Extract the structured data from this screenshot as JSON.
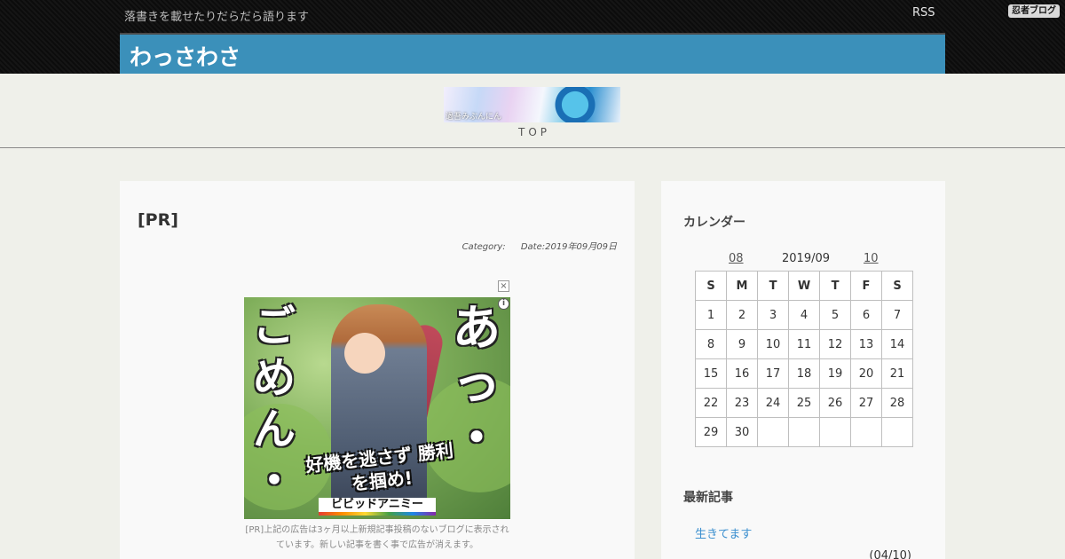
{
  "header": {
    "tagline": "落書きを載せたりだらだら語ります",
    "rss_label": "RSS",
    "ninja_logo_text": "忍者ブログ",
    "site_title": "わっさわさ"
  },
  "banner": {
    "overlay_text": "過吾みぶんにん",
    "top_link": "TOP"
  },
  "entry": {
    "title": "[PR]",
    "category_label": "Category:",
    "date_label": "Date:2019年09月09日"
  },
  "ad": {
    "close_glyph": "×",
    "info_glyph": "i",
    "text_left": "ご\nめ\nん\n・",
    "text_right": "あ\nっ\n・",
    "slogan": "好機を逃さず 勝利を掴め!",
    "brand": "ビビッドアニミー",
    "note": "[PR]上記の広告は3ヶ月以上新規記事投稿のないブログに表示されています。新しい記事を書く事で広告が消えます。"
  },
  "sidebar": {
    "calendar": {
      "heading": "カレンダー",
      "prev": "08",
      "current": "2019/09",
      "next": "10",
      "weekdays": [
        "S",
        "M",
        "T",
        "W",
        "T",
        "F",
        "S"
      ],
      "weeks": [
        [
          "1",
          "2",
          "3",
          "4",
          "5",
          "6",
          "7"
        ],
        [
          "8",
          "9",
          "10",
          "11",
          "12",
          "13",
          "14"
        ],
        [
          "15",
          "16",
          "17",
          "18",
          "19",
          "20",
          "21"
        ],
        [
          "22",
          "23",
          "24",
          "25",
          "26",
          "27",
          "28"
        ],
        [
          "29",
          "30",
          "",
          "",
          "",
          "",
          ""
        ]
      ]
    },
    "latest": {
      "heading": "最新記事",
      "items": [
        {
          "title": "生きてます",
          "date": "(04/10)"
        }
      ]
    }
  }
}
